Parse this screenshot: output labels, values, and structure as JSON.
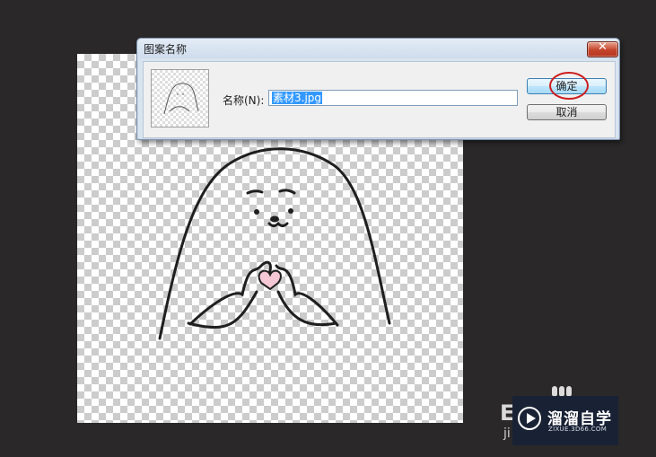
{
  "dialog": {
    "title": "图案名称",
    "close_glyph": "✕",
    "name_label": "名称(N):",
    "name_value": "素材3.jpg",
    "ok_label": "确定",
    "cancel_label": "取消"
  },
  "watermark": {
    "title": "溜溜自学",
    "url": "ZIXUE.3D66.COM",
    "left_text": "E",
    "left_small": "ji"
  },
  "colors": {
    "app_background": "#2a2828",
    "highlight_ring": "#cc1f1f",
    "heart_fill": "#f5c8d6",
    "selection": "#3399ff"
  }
}
